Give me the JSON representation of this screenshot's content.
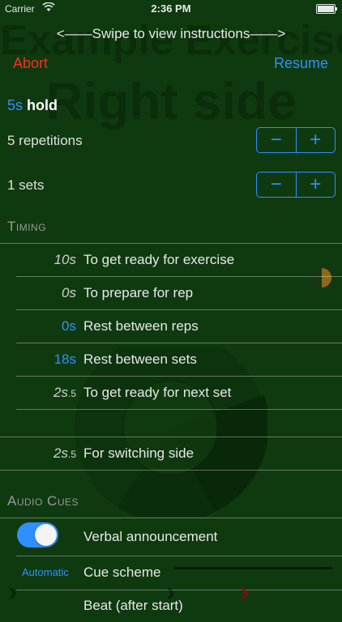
{
  "status_bar": {
    "carrier": "Carrier",
    "time": "2:36 PM"
  },
  "background": {
    "exercise_title": "Example Exercise",
    "side": "Right side"
  },
  "header": {
    "swipe_hint": "<——Swipe to view instructions——>",
    "abort_label": "Abort",
    "resume_label": "Resume"
  },
  "hold": {
    "value": "5s",
    "label": "hold"
  },
  "repetitions": {
    "label": "5 repetitions",
    "minus": "−",
    "plus": "+"
  },
  "sets": {
    "label": "1 sets",
    "minus": "−",
    "plus": "+"
  },
  "timing": {
    "header": "Timing",
    "rows": [
      {
        "value": "10s",
        "description": "To get ready for exercise"
      },
      {
        "value": "0s",
        "description": "To prepare for rep"
      },
      {
        "value": "0s",
        "description": "Rest between reps"
      },
      {
        "value": "18s",
        "description": "Rest between sets"
      },
      {
        "value_main": "2s",
        "value_frac": ".5",
        "description": "To get ready for next set"
      },
      {
        "value_main": "2s",
        "value_frac": ".5",
        "description": "For switching side"
      }
    ]
  },
  "audio": {
    "header": "Audio Cues",
    "verbal_label": "Verbal announcement",
    "verbal_enabled": true,
    "cue_scheme_value": "Automatic",
    "cue_scheme_label": "Cue scheme",
    "beat_label": "Beat (after start)"
  },
  "colors": {
    "background": "#0f3a10",
    "accent": "#2f8fff",
    "abort": "#ff2d1a",
    "muted_text": "#9a9a9a"
  },
  "icons": [
    "wifi-icon",
    "battery-icon",
    "timer-dial-icon",
    "chevron-icon"
  ]
}
